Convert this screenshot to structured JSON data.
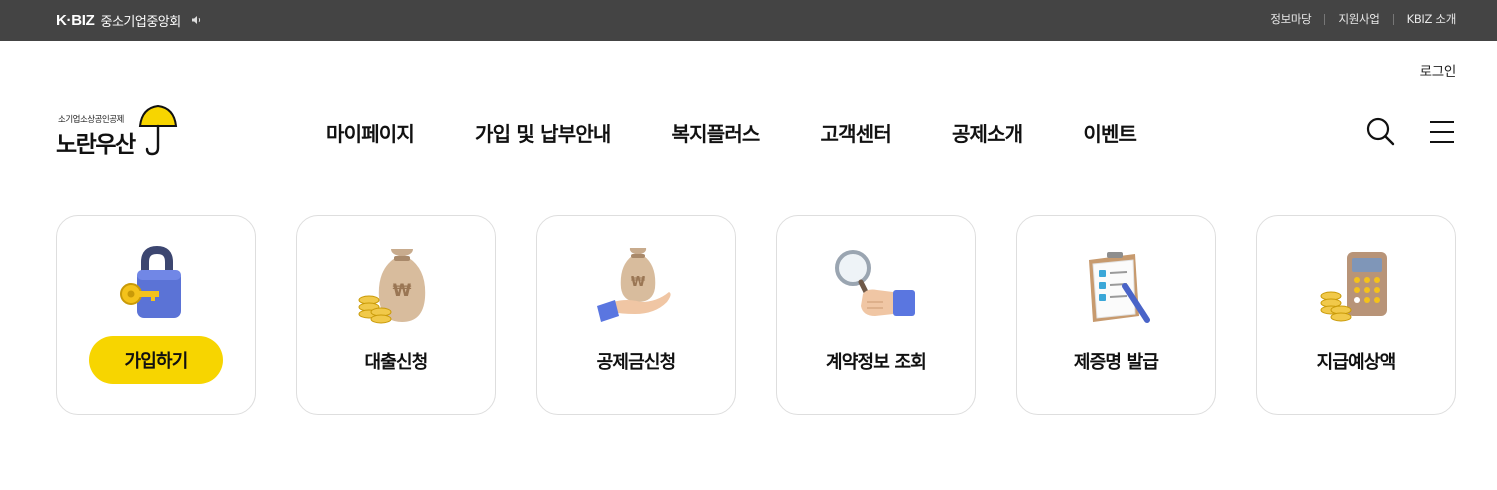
{
  "topbar": {
    "brand_mark": "K·BIZ",
    "brand_org": "중소기업중앙회",
    "links": [
      "정보마당",
      "지원사업",
      "KBIZ 소개"
    ]
  },
  "header": {
    "login": "로그인",
    "logo_sub": "소기업소상공인공제",
    "logo_main": "노란우산",
    "nav": [
      "마이페이지",
      "가입 및 납부안내",
      "복지플러스",
      "고객센터",
      "공제소개",
      "이벤트"
    ]
  },
  "cards": [
    {
      "label": "가입하기",
      "icon": "lock-key-icon",
      "highlight": true
    },
    {
      "label": "대출신청",
      "icon": "money-bag-coins-icon"
    },
    {
      "label": "공제금신청",
      "icon": "hand-money-bag-icon"
    },
    {
      "label": "계약정보 조회",
      "icon": "magnifier-hand-icon"
    },
    {
      "label": "제증명 발급",
      "icon": "checklist-pen-icon"
    },
    {
      "label": "지급예상액",
      "icon": "calculator-coins-icon"
    }
  ],
  "colors": {
    "topbar": "#444444",
    "accent_yellow": "#f7d500",
    "card_border": "#dedede"
  }
}
